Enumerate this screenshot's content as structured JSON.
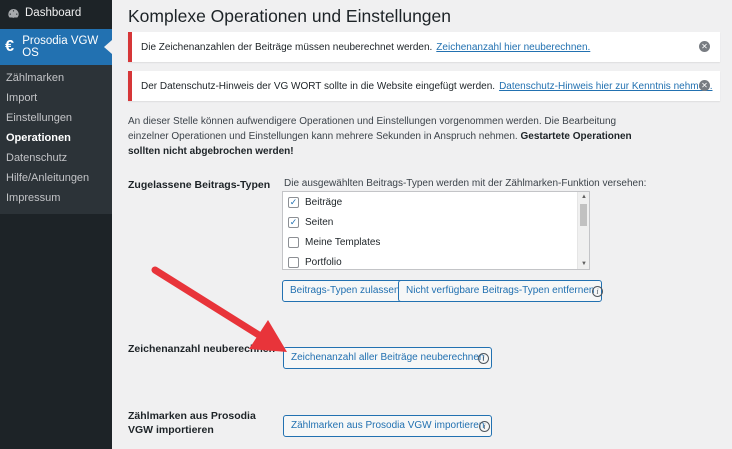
{
  "sidebar": {
    "dashboard_label": "Dashboard",
    "current_label": "Prosodia VGW OS",
    "items": [
      {
        "label": "Zählmarken",
        "active": false
      },
      {
        "label": "Import",
        "active": false
      },
      {
        "label": "Einstellungen",
        "active": false
      },
      {
        "label": "Operationen",
        "active": true
      },
      {
        "label": "Datenschutz",
        "active": false
      },
      {
        "label": "Hilfe/Anleitungen",
        "active": false
      },
      {
        "label": "Impressum",
        "active": false
      }
    ]
  },
  "page": {
    "title": "Komplexe Operationen und Einstellungen"
  },
  "notices": [
    {
      "text": "Die Zeichenanzahlen der Beiträge müssen neuberechnet werden.",
      "link": "Zeichenanzahl hier neuberechnen."
    },
    {
      "text": "Der Datenschutz-Hinweis der VG WORT sollte in die Website eingefügt werden.",
      "link": "Datenschutz-Hinweis hier zur Kenntnis nehmen."
    }
  ],
  "intro": {
    "text": "An dieser Stelle können aufwendigere Operationen und Einstellungen vorgenommen werden. Die Bearbeitung einzelner Operationen und Einstellungen kann mehrere Sekunden in Anspruch nehmen.",
    "bold": "Gestartete Operationen sollten nicht abgebrochen werden!"
  },
  "post_types": {
    "label": "Zugelassene Beitrags-Typen",
    "description": "Die ausgewählten Beitrags-Typen werden mit der Zählmarken-Funktion versehen:",
    "options": [
      {
        "label": "Beiträge",
        "checked": true
      },
      {
        "label": "Seiten",
        "checked": true
      },
      {
        "label": "Meine Templates",
        "checked": false
      },
      {
        "label": "Portfolio",
        "checked": false
      }
    ],
    "allow_button": "Beitrags-Typen zulassen",
    "remove_button": "Nicht verfügbare Beitrags-Typen entfernen"
  },
  "recalc": {
    "label": "Zeichenanzahl neuberechnen",
    "button": "Zeichenanzahl aller Beiträge neuberechnen"
  },
  "import": {
    "label": "Zählmarken aus Prosodia VGW importieren",
    "button": "Zählmarken aus Prosodia VGW importieren"
  },
  "colors": {
    "accent": "#2271b1",
    "notice_border": "#d63638",
    "sidebar_bg": "#1d2327",
    "arrow": "#e8343a"
  }
}
